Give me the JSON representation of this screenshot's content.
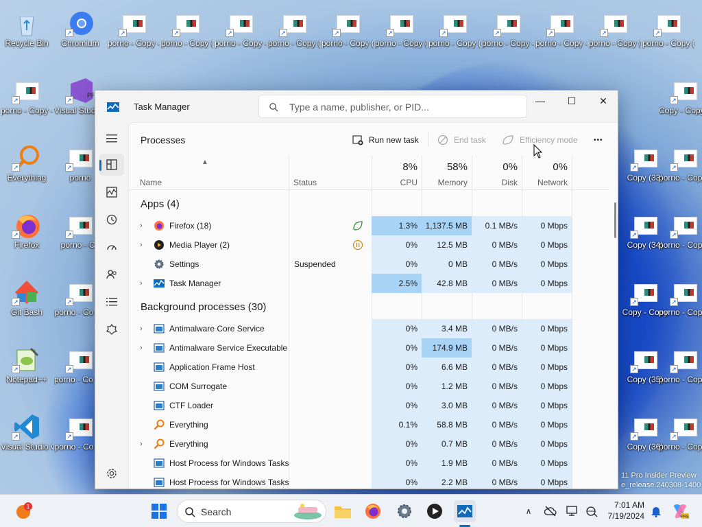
{
  "desktop": {
    "icons": [
      {
        "label": "Recycle Bin",
        "x": 0,
        "y": 0,
        "kind": "recycle"
      },
      {
        "label": "Chromium",
        "kind": "chromium"
      },
      {
        "label": "porno - Copy - Copy (3)"
      },
      {
        "label": "porno - Copy (7)"
      },
      {
        "label": "porno - Copy - Copy (10)"
      },
      {
        "label": "porno - Copy (14)"
      },
      {
        "label": "porno - Copy (17)"
      },
      {
        "label": "porno - Copy (21)"
      },
      {
        "label": "porno - Copy (24)"
      },
      {
        "label": "porno - Copy - Copy (28)"
      },
      {
        "label": "porno - Copy - Copy (31)"
      },
      {
        "label": "porno - Copy (34)"
      },
      {
        "label": "porno - Copy (34) - Copy"
      }
    ],
    "left_column": [
      {
        "label": "porno - Copy - Copy"
      },
      {
        "label": "Visual Studio 2022 Preview"
      },
      {
        "label": "Everything"
      },
      {
        "label": "porno"
      },
      {
        "label": "Firefox"
      },
      {
        "label": "porno - Co"
      },
      {
        "label": "Git Bash"
      },
      {
        "label": "porno - Co (2)"
      },
      {
        "label": "Notepad++"
      },
      {
        "label": "porno - Co - Copy (2"
      },
      {
        "label": "Visual Studio Code"
      },
      {
        "label": "porno - Co (3)"
      }
    ],
    "right_column": [
      {
        "label": "Copy - Copy (37)"
      },
      {
        "label": "Copy (33)"
      },
      {
        "label": "porno - Copy (38)"
      },
      {
        "label": "Copy (34)"
      },
      {
        "label": "porno - Copy (35) - Copy"
      },
      {
        "label": "Copy - Copy"
      },
      {
        "label": "porno - Copy (39) - Copy"
      },
      {
        "label": "Copy (35)"
      },
      {
        "label": "porno - Copy - Copy (40)"
      },
      {
        "label": "Copy (36)"
      },
      {
        "label": "porno - Copy (36) - Copy"
      }
    ],
    "watermark_line1": "11 Pro Insider Preview",
    "watermark_line2": "e_release.240308-1400"
  },
  "window": {
    "title": "Task Manager",
    "search_placeholder": "Type a name, publisher, or PID...",
    "minimize": "—",
    "maximize": "☐",
    "close": "✕"
  },
  "toolbar": {
    "page_title": "Processes",
    "run_new_task": "Run new task",
    "end_task": "End task",
    "efficiency_mode": "Efficiency mode",
    "more": "•••"
  },
  "columns": {
    "name": "Name",
    "status": "Status",
    "cpu_pct": "8%",
    "cpu": "CPU",
    "memory_pct": "58%",
    "memory": "Memory",
    "disk_pct": "0%",
    "disk": "Disk",
    "network_pct": "0%",
    "network": "Network"
  },
  "groups": {
    "apps": "Apps (4)",
    "background": "Background processes (30)"
  },
  "apps": [
    {
      "name": "Firefox (18)",
      "status": "",
      "cpu": "1.3%",
      "memory": "1,137.5 MB",
      "disk": "0.1 MB/s",
      "network": "0 Mbps",
      "expand": true,
      "icon": "firefox"
    },
    {
      "name": "Media Player (2)",
      "status": "",
      "cpu": "0%",
      "memory": "12.5 MB",
      "disk": "0 MB/s",
      "network": "0 Mbps",
      "expand": true,
      "icon": "media"
    },
    {
      "name": "Settings",
      "status": "Suspended",
      "cpu": "0%",
      "memory": "0 MB",
      "disk": "0 MB/s",
      "network": "0 Mbps",
      "expand": false,
      "icon": "gear"
    },
    {
      "name": "Task Manager",
      "status": "",
      "cpu": "2.5%",
      "memory": "42.8 MB",
      "disk": "0 MB/s",
      "network": "0 Mbps",
      "expand": true,
      "icon": "tm"
    }
  ],
  "background": [
    {
      "name": "Antimalware Core Service",
      "cpu": "0%",
      "memory": "3.4 MB",
      "disk": "0 MB/s",
      "network": "0 Mbps",
      "expand": true,
      "icon": "win"
    },
    {
      "name": "Antimalware Service Executable",
      "cpu": "0%",
      "memory": "174.9 MB",
      "disk": "0 MB/s",
      "network": "0 Mbps",
      "expand": true,
      "icon": "win"
    },
    {
      "name": "Application Frame Host",
      "cpu": "0%",
      "memory": "6.6 MB",
      "disk": "0 MB/s",
      "network": "0 Mbps",
      "expand": false,
      "icon": "win"
    },
    {
      "name": "COM Surrogate",
      "cpu": "0%",
      "memory": "1.2 MB",
      "disk": "0 MB/s",
      "network": "0 Mbps",
      "expand": false,
      "icon": "win"
    },
    {
      "name": "CTF Loader",
      "cpu": "0%",
      "memory": "3.0 MB",
      "disk": "0 MB/s",
      "network": "0 Mbps",
      "expand": false,
      "icon": "win"
    },
    {
      "name": "Everything",
      "cpu": "0.1%",
      "memory": "58.8 MB",
      "disk": "0 MB/s",
      "network": "0 Mbps",
      "expand": false,
      "icon": "everything"
    },
    {
      "name": "Everything",
      "cpu": "0%",
      "memory": "0.7 MB",
      "disk": "0 MB/s",
      "network": "0 Mbps",
      "expand": true,
      "icon": "everything"
    },
    {
      "name": "Host Process for Windows Tasks",
      "cpu": "0%",
      "memory": "1.9 MB",
      "disk": "0 MB/s",
      "network": "0 Mbps",
      "expand": false,
      "icon": "win"
    },
    {
      "name": "Host Process for Windows Tasks",
      "cpu": "0%",
      "memory": "2.2 MB",
      "disk": "0 MB/s",
      "network": "0 Mbps",
      "expand": false,
      "icon": "win"
    }
  ],
  "taskbar": {
    "search_label": "Search",
    "time": "7:01 AM",
    "date": "7/19/2024",
    "notification_count": "1"
  },
  "colors": {
    "accent": "#0f6cbd",
    "heat_low": "#dcecfb",
    "heat_mid": "#c5e2f9",
    "heat_high": "#a7d3f7"
  }
}
